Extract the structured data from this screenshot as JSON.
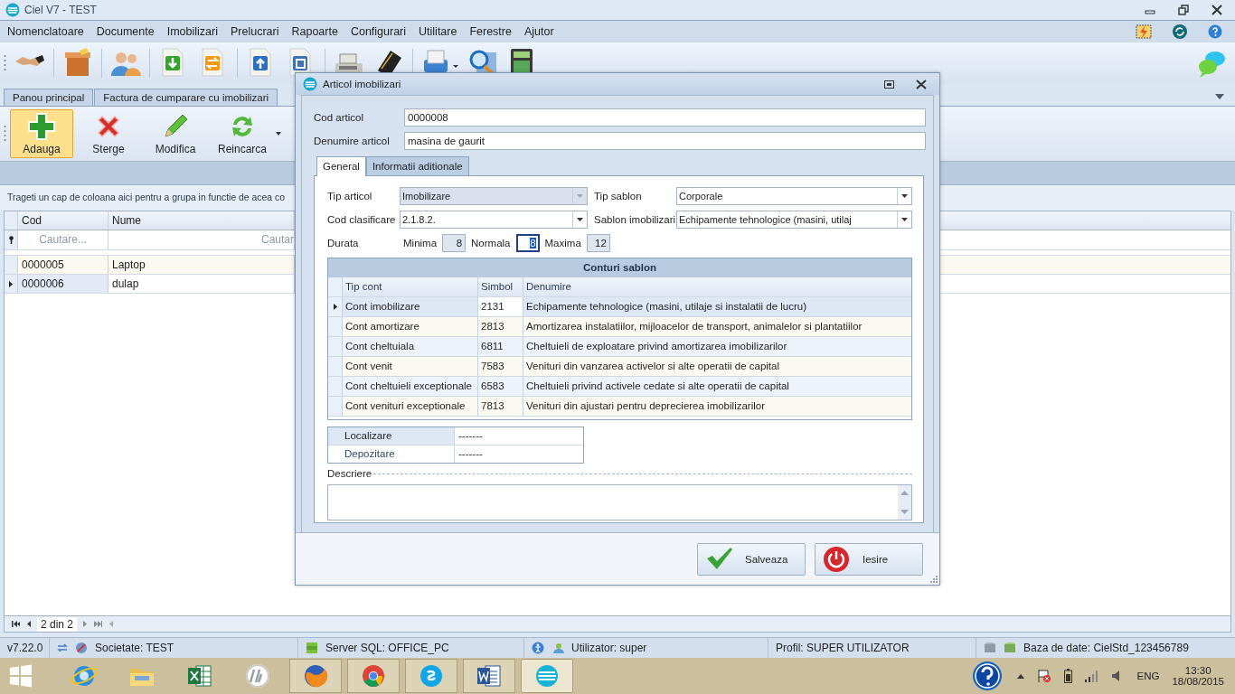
{
  "window": {
    "title": "Ciel V7 - TEST"
  },
  "menu": [
    "Nomenclatoare",
    "Documente",
    "Imobilizari",
    "Prelucrari",
    "Rapoarte",
    "Configurari",
    "Utilitare",
    "Ferestre",
    "Ajutor"
  ],
  "doc_tabs": [
    {
      "label": "Panou principal",
      "selected": false
    },
    {
      "label": "Factura de cumparare cu imobilizari",
      "selected": false
    }
  ],
  "actions": [
    {
      "label": "Adauga",
      "kind": "add",
      "highlighted": true,
      "has_dropdown": false
    },
    {
      "label": "Sterge",
      "kind": "delete",
      "highlighted": false,
      "has_dropdown": false
    },
    {
      "label": "Modifica",
      "kind": "edit",
      "highlighted": false,
      "has_dropdown": false
    },
    {
      "label": "Reincarca",
      "kind": "reload",
      "highlighted": false,
      "has_dropdown": true
    }
  ],
  "group_panel": {
    "hint": "Trageti un cap de coloana aici pentru a grupa in functie de acea co"
  },
  "grid": {
    "columns": [
      "Cod",
      "Nume"
    ],
    "filter": [
      "Cautare...",
      "Cautar"
    ],
    "rows": [
      {
        "cells": [
          "0000005",
          "Laptop"
        ],
        "current": false
      },
      {
        "cells": [
          "0000006",
          "dulap"
        ],
        "current": true
      }
    ]
  },
  "pager": {
    "position": "2 din 2"
  },
  "status_bar": {
    "version": "v7.22.0",
    "company": "Societate: TEST",
    "server": "Server SQL: OFFICE_PC",
    "user": "Utilizator: super",
    "profile": "Profil: SUPER UTILIZATOR",
    "database": "Baza de date: CielStd_123456789"
  },
  "taskbar": {
    "apps": [
      {
        "kind": "browser",
        "running": false,
        "active": false
      },
      {
        "kind": "folder",
        "running": false,
        "active": false
      },
      {
        "kind": "sheet",
        "running": false,
        "active": false
      },
      {
        "kind": "printer",
        "running": false,
        "active": false
      },
      {
        "kind": "fox",
        "running": true,
        "active": false
      },
      {
        "kind": "chrome",
        "running": true,
        "active": false
      },
      {
        "kind": "chat",
        "running": true,
        "active": false
      },
      {
        "kind": "doc",
        "running": true,
        "active": false
      },
      {
        "kind": "ciel",
        "running": true,
        "active": true
      }
    ],
    "language": "ENG",
    "time": "13:30",
    "date": "18/08/2015"
  },
  "dialog": {
    "title": "Articol imobilizari",
    "fields": [
      {
        "label": "Cod articol",
        "value": "0000008"
      },
      {
        "label": "Denumire articol",
        "value": "masina de gaurit"
      }
    ],
    "tabs": [
      {
        "label": "General",
        "selected": true
      },
      {
        "label": "Informatii aditionale",
        "selected": false
      }
    ],
    "combos": [
      {
        "label": "Tip articol",
        "value": "Imobilizare",
        "disabled": true
      },
      {
        "label": "Tip sablon",
        "value": "Corporale",
        "disabled": false
      },
      {
        "label": "Cod clasificare",
        "value": "2.1.8.2.",
        "disabled": false
      },
      {
        "label": "Sablon imobilizari",
        "value": "Echipamente tehnologice (masini, utilaj",
        "disabled": false
      }
    ],
    "duration": {
      "label": "Durata",
      "parts": [
        {
          "label": "Minima",
          "value": "8",
          "disabled": true,
          "focused": false
        },
        {
          "label": "Normala",
          "value": "8",
          "disabled": false,
          "focused": true
        },
        {
          "label": "Maxima",
          "value": "12",
          "disabled": true,
          "focused": false
        }
      ]
    },
    "accounts": {
      "title": "Conturi sablon",
      "columns": [
        "Tip cont",
        "Simbol",
        "Denumire"
      ],
      "rows": [
        {
          "cells": [
            "Cont imobilizare",
            "2131",
            "Echipamente tehnologice (masini, utilaje si instalatii de lucru)"
          ],
          "current": true
        },
        {
          "cells": [
            "Cont amortizare",
            "2813",
            "Amortizarea instalatiilor, mijloacelor de transport, animalelor si plantatiilor"
          ],
          "current": false
        },
        {
          "cells": [
            "Cont cheltuiala",
            "6811",
            "Cheltuieli de exploatare privind amortizarea imobilizarilor"
          ],
          "current": false
        },
        {
          "cells": [
            "Cont venit",
            "7583",
            "Venituri din vanzarea activelor si alte operatii de capital"
          ],
          "current": false
        },
        {
          "cells": [
            "Cont cheltuieli exceptionale",
            "6583",
            "Cheltuieli privind activele cedate si alte operatii de capital"
          ],
          "current": false
        },
        {
          "cells": [
            "Cont venituri exceptionale",
            "7813",
            "Venituri din ajustari pentru deprecierea imobilizarilor"
          ],
          "current": false
        }
      ]
    },
    "properties": [
      {
        "label": "Localizare",
        "value": "-------",
        "selected": true
      },
      {
        "label": "Depozitare",
        "value": "-------",
        "selected": false
      }
    ],
    "description": {
      "label": "Descriere"
    },
    "buttons": [
      {
        "label": "Salveaza",
        "kind": "save"
      },
      {
        "label": "Iesire",
        "kind": "exit"
      }
    ]
  }
}
